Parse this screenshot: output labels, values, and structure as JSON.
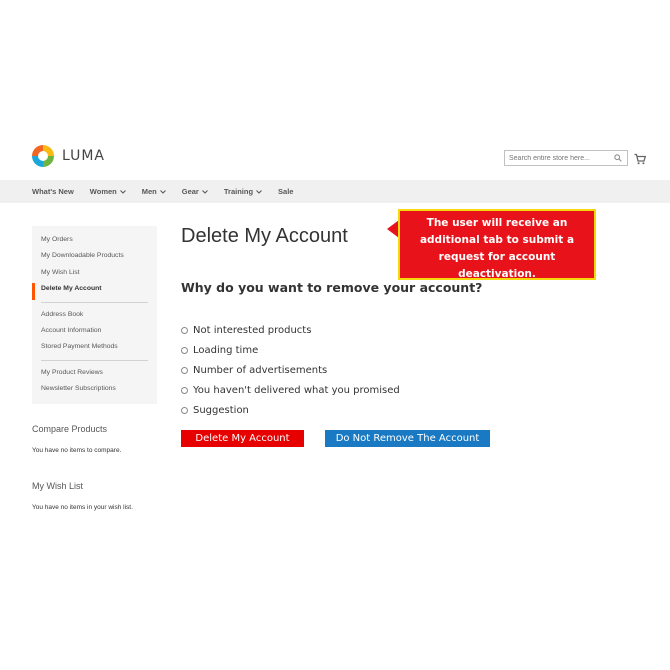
{
  "header": {
    "logo_text": "LUMA",
    "search_placeholder": "Search entire store here...",
    "icons": {
      "search": "search-icon",
      "cart": "cart-icon"
    }
  },
  "nav": {
    "items": [
      {
        "label": "What's New",
        "has_dropdown": false
      },
      {
        "label": "Women",
        "has_dropdown": true
      },
      {
        "label": "Men",
        "has_dropdown": true
      },
      {
        "label": "Gear",
        "has_dropdown": true
      },
      {
        "label": "Training",
        "has_dropdown": true
      },
      {
        "label": "Sale",
        "has_dropdown": false
      }
    ]
  },
  "sidebar": {
    "groups": [
      [
        "My Orders",
        "My Downloadable Products",
        "My Wish List",
        "Delete My Account"
      ],
      [
        "Address Book",
        "Account Information",
        "Stored Payment Methods"
      ],
      [
        "My Product Reviews",
        "Newsletter Subscriptions"
      ]
    ],
    "active": "Delete My Account",
    "compare_title": "Compare Products",
    "compare_text": "You have no items to compare.",
    "wishlist_title": "My Wish List",
    "wishlist_text": "You have no items in your wish list."
  },
  "main": {
    "title": "Delete My Account",
    "question": "Why do you want to remove your account?",
    "options": [
      "Not interested products",
      "Loading time",
      "Number of advertisements",
      "You haven't delivered what you promised",
      "Suggestion"
    ],
    "delete_button": "Delete My Account",
    "keep_button": "Do Not Remove The Account"
  },
  "callout": {
    "lines": [
      "The user will receive an",
      "additional tab to submit a",
      "request for account deactivation."
    ]
  },
  "colors": {
    "accent_orange": "#ff5501",
    "delete_red": "#e60000",
    "keep_blue": "#1979c3",
    "callout_red": "#e8131a",
    "callout_border": "#f5d90a"
  }
}
